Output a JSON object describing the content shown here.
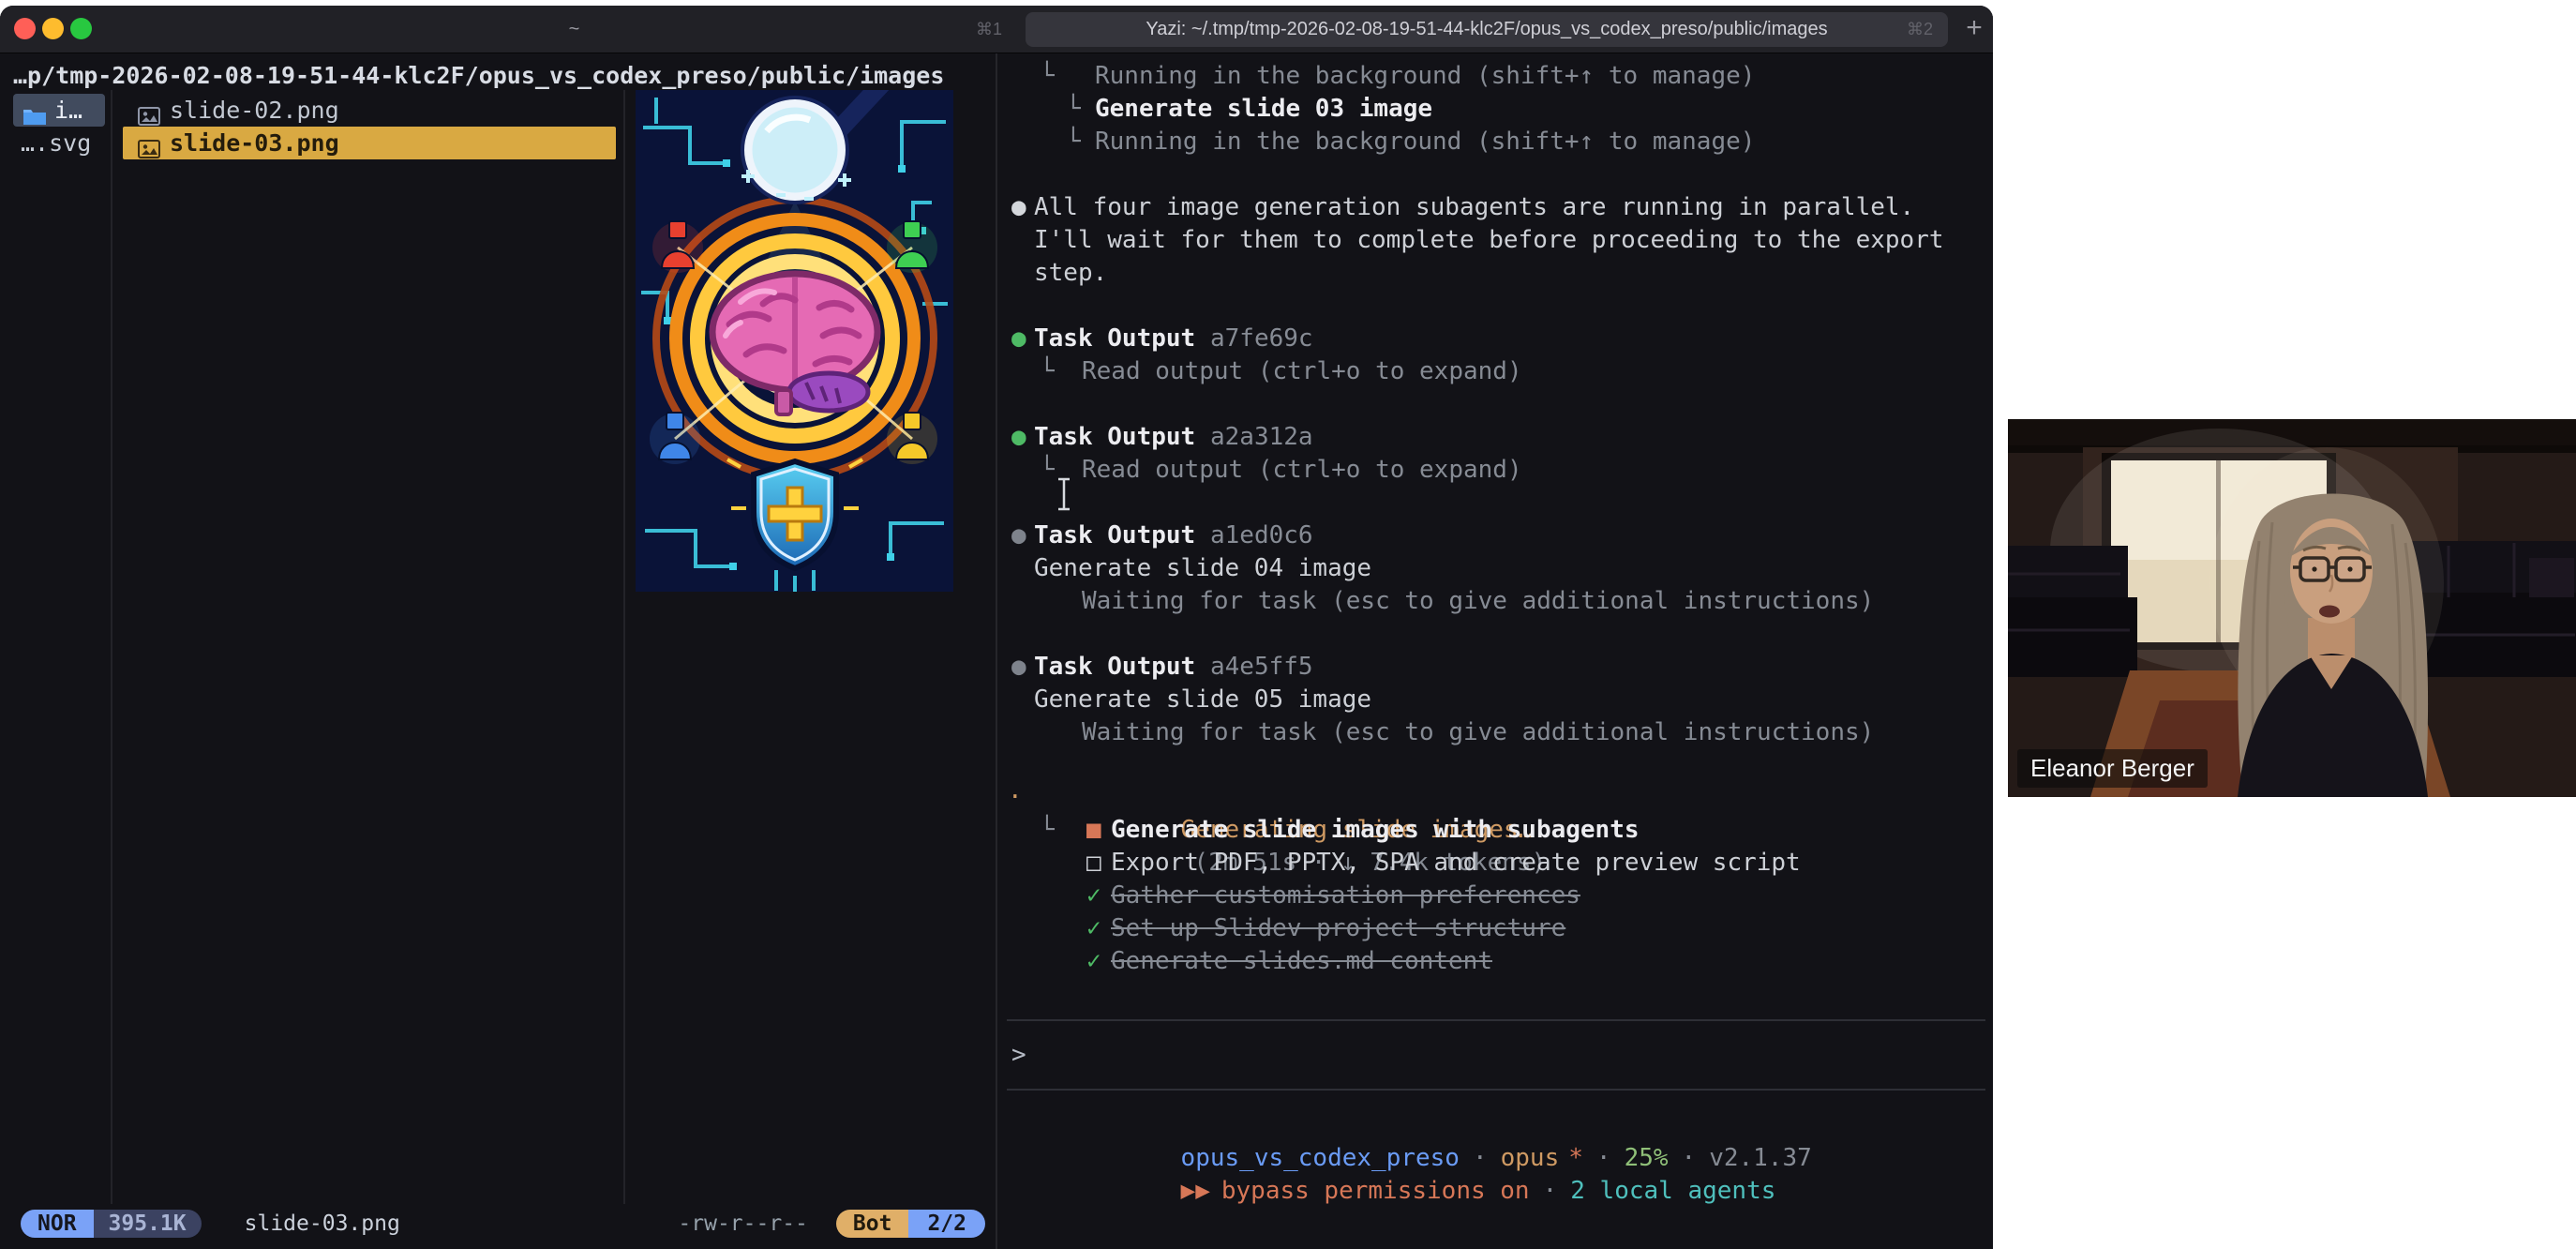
{
  "colors": {
    "accent_yellow": "#d9a942",
    "accent_blue": "#6a9bf5",
    "accent_orange": "#d77757",
    "accent_green": "#4eba65",
    "accent_cyan": "#4fc0bd",
    "accent_tan": "#cf9a63"
  },
  "titlebar": {
    "home_tab": {
      "label": "~",
      "shortcut": "⌘1"
    },
    "active_tab": {
      "label": "Yazi: ~/.tmp/tmp-2026-02-08-19-51-44-klc2F/opus_vs_codex_preso/public/images",
      "shortcut": "⌘2"
    },
    "new_tab_label": "+"
  },
  "yazi": {
    "breadcrumb": "…p/tmp-2026-02-08-19-51-44-klc2F/opus_vs_codex_preso/public/images",
    "parent_items": [
      {
        "label": "i…"
      },
      {
        "label": "….svg"
      }
    ],
    "files": [
      {
        "name": "slide-02.png"
      },
      {
        "name": "slide-03.png"
      }
    ],
    "statusbar": {
      "mode": "NOR",
      "size": "395.1K",
      "filename": "slide-03.png",
      "permissions": "-rw-r--r--",
      "position": "Bot",
      "counter": "2/2"
    }
  },
  "claude": {
    "glyphs": {
      "tree": "└",
      "branch": "└",
      "bullet": "●",
      "spinner": "·",
      "box_active": "■",
      "box_open": "□",
      "check": "✓",
      "prompt": ">",
      "arrows": "▶▶"
    },
    "background_tasks": {
      "running_1": "Running in the background (shift+↑ to manage)",
      "task_title": "Generate slide 03 image",
      "running_2": "Running in the background (shift+↑ to manage)"
    },
    "message": {
      "line_1": "All four image generation subagents are running in parallel.",
      "line_2": "I'll wait for them to complete before proceeding to the export",
      "line_3": "step."
    },
    "task_outputs": [
      {
        "label": "Task Output",
        "id": "a7fe69c",
        "detail": "Read output (ctrl+o to expand)"
      },
      {
        "label": "Task Output",
        "id": "a2a312a",
        "detail": "Read output (ctrl+o to expand)"
      },
      {
        "label": "Task Output",
        "id": "a1ed0c6",
        "task": "Generate slide 04 image",
        "waiting": "Waiting for task (esc to give additional instructions)"
      },
      {
        "label": "Task Output",
        "id": "a4e5ff5",
        "task": "Generate slide 05 image",
        "waiting": "Waiting for task (esc to give additional instructions)"
      }
    ],
    "progress": {
      "title": "Generating slide images…",
      "meta": "(2m 51s · ↓ 7.4k tokens)"
    },
    "todos": [
      {
        "state": "active",
        "label": "Generate slide images with subagents"
      },
      {
        "state": "open",
        "label": "Export PDF, PPTX, SPA and create preview script"
      },
      {
        "state": "done",
        "label": "Gather customisation preferences"
      },
      {
        "state": "done",
        "label": "Set up Slidev project structure"
      },
      {
        "state": "done",
        "label": "Generate slides.md content"
      }
    ],
    "statusline": {
      "project": "opus_vs_codex_preso",
      "sep": "·",
      "model": "opus",
      "model_star": "*",
      "context": "25%",
      "version": "v2.1.37"
    },
    "permissions": {
      "arrows": "▶▶",
      "label": "bypass permissions on",
      "sep": "·",
      "agents": "2 local agents"
    }
  },
  "webcam": {
    "name": "Eleanor Berger"
  }
}
